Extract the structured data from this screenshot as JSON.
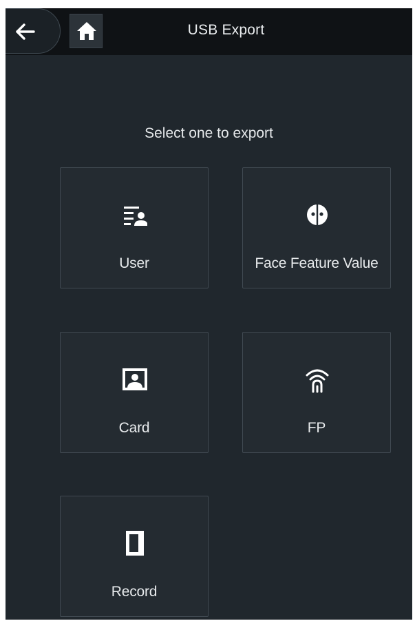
{
  "header": {
    "title": "USB Export",
    "back_icon": "arrow-left-icon",
    "home_icon": "home-icon"
  },
  "prompt": "Select one to export",
  "options": [
    {
      "label": "User",
      "icon": "user-list-icon"
    },
    {
      "label": "Face Feature Value",
      "icon": "face-icon"
    },
    {
      "label": "Card",
      "icon": "card-icon"
    },
    {
      "label": "FP",
      "icon": "fingerprint-icon"
    },
    {
      "label": "Record",
      "icon": "record-door-icon"
    }
  ],
  "colors": {
    "background": "#20272d",
    "header": "#0f1215",
    "tile": "#242b31",
    "tile_border": "#414a52",
    "text": "#e8ebed"
  }
}
